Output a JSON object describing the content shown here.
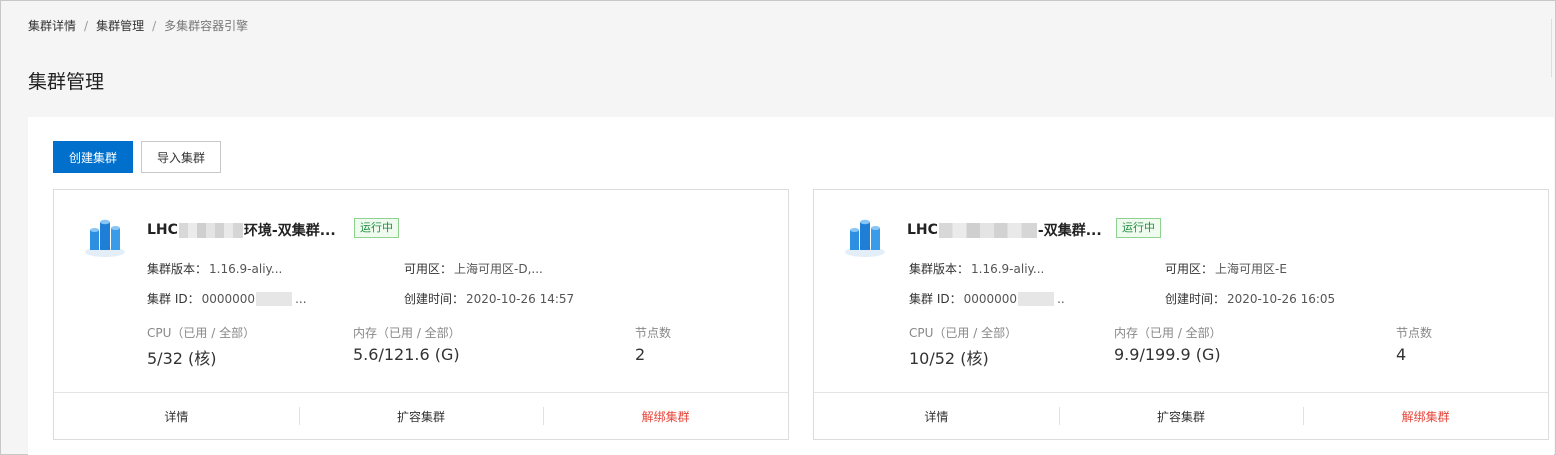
{
  "breadcrumb": [
    "集群详情",
    "集群管理",
    "多集群容器引擎"
  ],
  "page_title": "集群管理",
  "toolbar": {
    "create_label": "创建集群",
    "import_label": "导入集群"
  },
  "colors": {
    "primary": "#0070cc",
    "running": "#1e8e3e",
    "danger": "#e5453a"
  },
  "cards": [
    {
      "title_prefix": "LHC",
      "title_suffix": "环境-双集群...",
      "status": "运行中",
      "version_label": "集群版本：",
      "version_value": "1.16.9-aliy...",
      "zone_label": "可用区：",
      "zone_value": "上海可用区-D,...",
      "id_label": "集群 ID：",
      "id_prefix": "0000000",
      "id_suffix": "...",
      "created_label": "创建时间：",
      "created_value": "2020-10-26 14:57",
      "cpu_label": "CPU（已用 / 全部）",
      "cpu_value": "5/32 (核)",
      "mem_label": "内存（已用 / 全部）",
      "mem_value": "5.6/121.6 (G)",
      "nodes_label": "节点数",
      "nodes_value": "2",
      "actions": [
        "详情",
        "扩容集群",
        "解绑集群"
      ]
    },
    {
      "title_prefix": "LHC",
      "title_suffix": "-双集群...",
      "status": "运行中",
      "version_label": "集群版本：",
      "version_value": "1.16.9-aliy...",
      "zone_label": "可用区：",
      "zone_value": "上海可用区-E",
      "id_label": "集群 ID：",
      "id_prefix": "0000000",
      "id_suffix": "..",
      "created_label": "创建时间：",
      "created_value": "2020-10-26 16:05",
      "cpu_label": "CPU（已用 / 全部）",
      "cpu_value": "10/52 (核)",
      "mem_label": "内存（已用 / 全部）",
      "mem_value": "9.9/199.9 (G)",
      "nodes_label": "节点数",
      "nodes_value": "4",
      "actions": [
        "详情",
        "扩容集群",
        "解绑集群"
      ]
    }
  ]
}
